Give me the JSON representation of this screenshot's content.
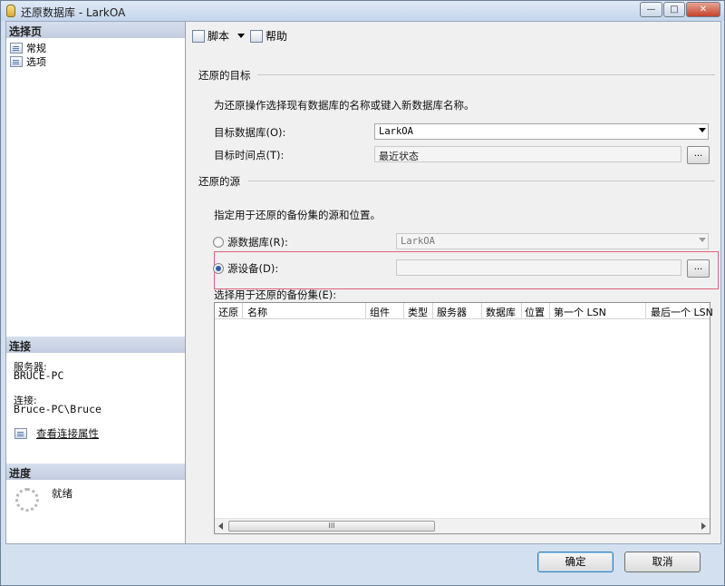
{
  "window": {
    "title": "还原数据库 - LarkOA",
    "min_glyph": "—",
    "max_glyph": "□",
    "close_glyph": "✕"
  },
  "left_pane": {
    "select_page_header": "选择页",
    "pages": [
      {
        "label": "常规",
        "icon": "page-icon"
      },
      {
        "label": "选项",
        "icon": "page-icon"
      }
    ],
    "connection_header": "连接",
    "server_label": "服务器:",
    "server_value": "BRUCE-PC",
    "connection_label": "连接:",
    "connection_value": "Bruce-PC\\Bruce",
    "view_properties_link": "查看连接属性",
    "progress_header": "进度",
    "progress_status": "就绪"
  },
  "toolbar": {
    "script_label": "脚本",
    "help_label": "帮助"
  },
  "target": {
    "section_title": "还原的目标",
    "description": "为还原操作选择现有数据库的名称或键入新数据库名称。",
    "target_db_label": "目标数据库(O):",
    "target_db_value": "LarkOA",
    "target_time_label": "目标时间点(T):",
    "target_time_value": "最近状态",
    "browse_label": "..."
  },
  "source": {
    "section_title": "还原的源",
    "description": "指定用于还原的备份集的源和位置。",
    "from_db_label": "源数据库(R):",
    "from_db_value": "LarkOA",
    "from_device_label": "源设备(D):",
    "from_device_value": "",
    "browse_label": "...",
    "selected_option": "from_device"
  },
  "backup_sets": {
    "label": "选择用于还原的备份集(E):",
    "columns": [
      "还原",
      "名称",
      "组件",
      "类型",
      "服务器",
      "数据库",
      "位置",
      "第一个 LSN",
      "最后一个 LSN"
    ],
    "rows": [],
    "scroll_grip": "III"
  },
  "footer": {
    "ok_label": "确定",
    "cancel_label": "取消"
  },
  "colors": {
    "highlight_border": "#e0607e",
    "title_bar": "#c4d6ec",
    "pane_header": "#c2cde0"
  }
}
